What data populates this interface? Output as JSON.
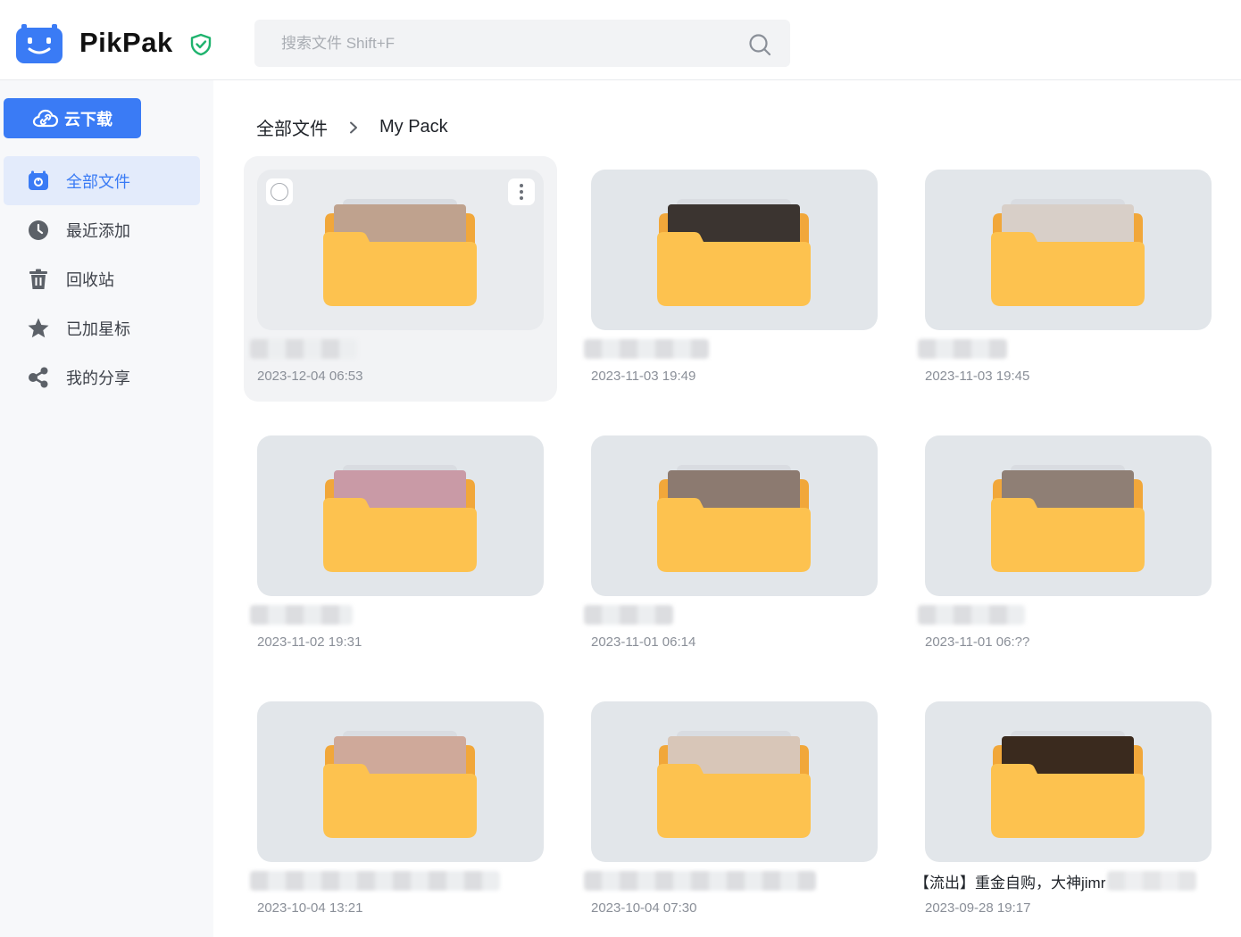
{
  "app": {
    "brand": "PikPak"
  },
  "search": {
    "placeholder": "搜索文件 Shift+F"
  },
  "sidebar": {
    "cloud_download": "云下载",
    "items": [
      {
        "label": "全部文件",
        "icon": "all-files-icon",
        "active": true
      },
      {
        "label": "最近添加",
        "icon": "clock-icon",
        "active": false
      },
      {
        "label": "回收站",
        "icon": "trash-icon",
        "active": false
      },
      {
        "label": "已加星标",
        "icon": "star-icon",
        "active": false
      },
      {
        "label": "我的分享",
        "icon": "share-icon",
        "active": false
      }
    ]
  },
  "breadcrumb": {
    "root": "全部文件",
    "current": "My Pack"
  },
  "colors": {
    "accent": "#3a7bf5",
    "folder": "#fdc24f",
    "folder_back": "#f1a73a",
    "shield": "#1fb36e"
  },
  "folders": [
    {
      "name": "",
      "date": "2023-12-04 06:53",
      "selected": true
    },
    {
      "name": "",
      "date": "2023-11-03 19:49",
      "selected": false
    },
    {
      "name": "",
      "date": "2023-11-03 19:45",
      "selected": false
    },
    {
      "name": "",
      "date": "2023-11-02 19:31",
      "selected": false
    },
    {
      "name": "",
      "date": "2023-11-01 06:14",
      "selected": false
    },
    {
      "name": "",
      "date": "2023-11-01 06:??",
      "selected": false
    },
    {
      "name": "",
      "date": "2023-10-04 13:21",
      "selected": false
    },
    {
      "name": "",
      "date": "2023-10-04 07:30",
      "selected": false
    },
    {
      "name": "【流出】重金自购，大神jimr",
      "date": "2023-09-28 19:17",
      "selected": false
    }
  ]
}
